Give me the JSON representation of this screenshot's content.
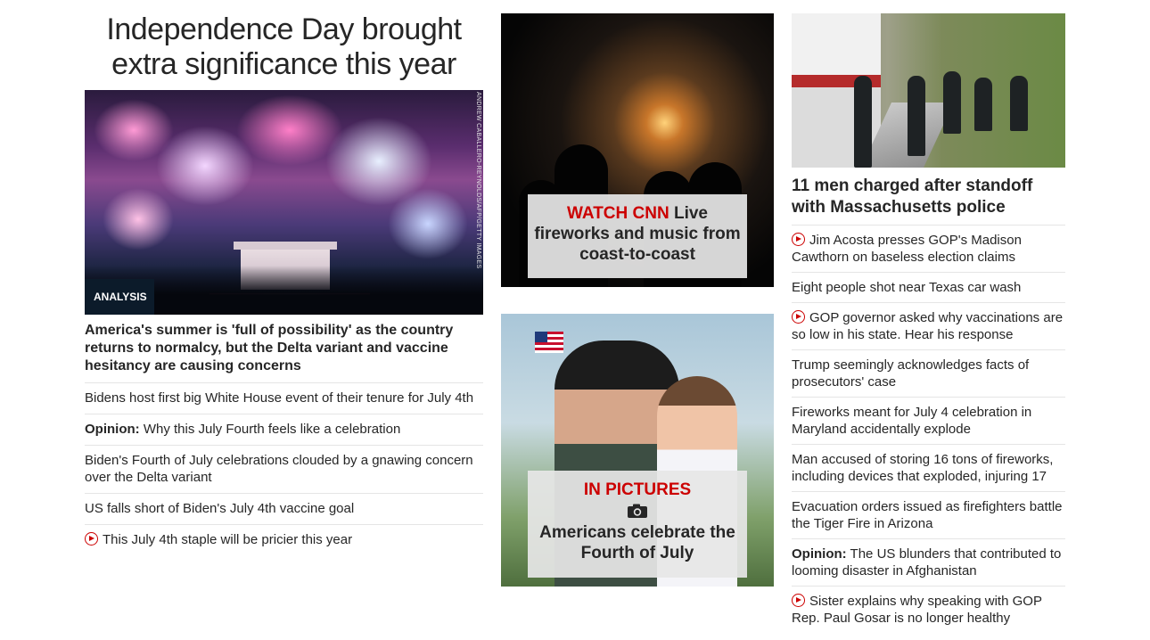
{
  "col1": {
    "headline": "Independence Day brought extra significance this year",
    "hero_credit": "ANDREW CABALLERO-REYNOLDS/AFP/GETTY IMAGES",
    "badge": "ANALYSIS",
    "subhead": "America's summer is 'full of possibility' as the country returns to normalcy, but the Delta variant and vaccine hesitancy are causing concerns",
    "items": [
      {
        "prefix": "",
        "text": "Bidens host first big White House event of their tenure for July 4th",
        "video": false
      },
      {
        "prefix": "Opinion:",
        "text": " Why this July Fourth feels like a celebration",
        "video": false
      },
      {
        "prefix": "",
        "text": "Biden's Fourth of July celebrations clouded by a gnawing concern over the Delta variant",
        "video": false
      },
      {
        "prefix": "",
        "text": "US falls short of Biden's July 4th vaccine goal",
        "video": false
      },
      {
        "prefix": "",
        "text": "This July 4th staple will be pricier this year",
        "video": true
      }
    ]
  },
  "col2": {
    "card1": {
      "highlight": "WATCH CNN",
      "text": " Live fireworks and music from coast-to-coast"
    },
    "card2": {
      "highlight": "IN PICTURES",
      "icon": "camera-icon",
      "text": "Americans celebrate the Fourth of July"
    }
  },
  "col3": {
    "title": "11 men charged after standoff with Massachusetts police",
    "items": [
      {
        "prefix": "",
        "text": "Jim Acosta presses GOP's Madison Cawthorn on baseless election claims",
        "video": true
      },
      {
        "prefix": "",
        "text": "Eight people shot near Texas car wash",
        "video": false
      },
      {
        "prefix": "",
        "text": "GOP governor asked why vaccinations are so low in his state. Hear his response",
        "video": true
      },
      {
        "prefix": "",
        "text": "Trump seemingly acknowledges facts of prosecutors' case",
        "video": false
      },
      {
        "prefix": "",
        "text": "Fireworks meant for July 4 celebration in Maryland accidentally explode",
        "video": false
      },
      {
        "prefix": "",
        "text": "Man accused of storing 16 tons of fireworks, including devices that exploded, injuring 17",
        "video": false
      },
      {
        "prefix": "",
        "text": "Evacuation orders issued as firefighters battle the Tiger Fire in Arizona",
        "video": false
      },
      {
        "prefix": "Opinion:",
        "text": " The US blunders that contributed to looming disaster in Afghanistan",
        "video": false
      },
      {
        "prefix": "",
        "text": "Sister explains why speaking with GOP Rep. Paul Gosar is no longer healthy",
        "video": true
      }
    ]
  },
  "colors": {
    "accent_red": "#cc0000",
    "text": "#262626",
    "badge_bg": "#0c1b2a",
    "divider": "#e5e5e5"
  }
}
